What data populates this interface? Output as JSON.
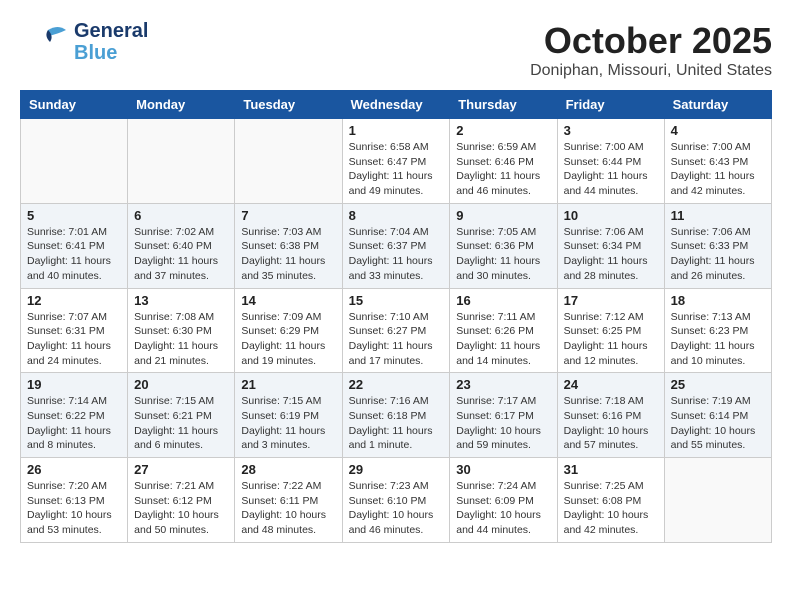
{
  "header": {
    "logo_general": "General",
    "logo_blue": "Blue",
    "month_year": "October 2025",
    "location": "Doniphan, Missouri, United States"
  },
  "weekdays": [
    "Sunday",
    "Monday",
    "Tuesday",
    "Wednesday",
    "Thursday",
    "Friday",
    "Saturday"
  ],
  "weeks": [
    [
      {
        "day": "",
        "info": ""
      },
      {
        "day": "",
        "info": ""
      },
      {
        "day": "",
        "info": ""
      },
      {
        "day": "1",
        "info": "Sunrise: 6:58 AM\nSunset: 6:47 PM\nDaylight: 11 hours and 49 minutes."
      },
      {
        "day": "2",
        "info": "Sunrise: 6:59 AM\nSunset: 6:46 PM\nDaylight: 11 hours and 46 minutes."
      },
      {
        "day": "3",
        "info": "Sunrise: 7:00 AM\nSunset: 6:44 PM\nDaylight: 11 hours and 44 minutes."
      },
      {
        "day": "4",
        "info": "Sunrise: 7:00 AM\nSunset: 6:43 PM\nDaylight: 11 hours and 42 minutes."
      }
    ],
    [
      {
        "day": "5",
        "info": "Sunrise: 7:01 AM\nSunset: 6:41 PM\nDaylight: 11 hours and 40 minutes."
      },
      {
        "day": "6",
        "info": "Sunrise: 7:02 AM\nSunset: 6:40 PM\nDaylight: 11 hours and 37 minutes."
      },
      {
        "day": "7",
        "info": "Sunrise: 7:03 AM\nSunset: 6:38 PM\nDaylight: 11 hours and 35 minutes."
      },
      {
        "day": "8",
        "info": "Sunrise: 7:04 AM\nSunset: 6:37 PM\nDaylight: 11 hours and 33 minutes."
      },
      {
        "day": "9",
        "info": "Sunrise: 7:05 AM\nSunset: 6:36 PM\nDaylight: 11 hours and 30 minutes."
      },
      {
        "day": "10",
        "info": "Sunrise: 7:06 AM\nSunset: 6:34 PM\nDaylight: 11 hours and 28 minutes."
      },
      {
        "day": "11",
        "info": "Sunrise: 7:06 AM\nSunset: 6:33 PM\nDaylight: 11 hours and 26 minutes."
      }
    ],
    [
      {
        "day": "12",
        "info": "Sunrise: 7:07 AM\nSunset: 6:31 PM\nDaylight: 11 hours and 24 minutes."
      },
      {
        "day": "13",
        "info": "Sunrise: 7:08 AM\nSunset: 6:30 PM\nDaylight: 11 hours and 21 minutes."
      },
      {
        "day": "14",
        "info": "Sunrise: 7:09 AM\nSunset: 6:29 PM\nDaylight: 11 hours and 19 minutes."
      },
      {
        "day": "15",
        "info": "Sunrise: 7:10 AM\nSunset: 6:27 PM\nDaylight: 11 hours and 17 minutes."
      },
      {
        "day": "16",
        "info": "Sunrise: 7:11 AM\nSunset: 6:26 PM\nDaylight: 11 hours and 14 minutes."
      },
      {
        "day": "17",
        "info": "Sunrise: 7:12 AM\nSunset: 6:25 PM\nDaylight: 11 hours and 12 minutes."
      },
      {
        "day": "18",
        "info": "Sunrise: 7:13 AM\nSunset: 6:23 PM\nDaylight: 11 hours and 10 minutes."
      }
    ],
    [
      {
        "day": "19",
        "info": "Sunrise: 7:14 AM\nSunset: 6:22 PM\nDaylight: 11 hours and 8 minutes."
      },
      {
        "day": "20",
        "info": "Sunrise: 7:15 AM\nSunset: 6:21 PM\nDaylight: 11 hours and 6 minutes."
      },
      {
        "day": "21",
        "info": "Sunrise: 7:15 AM\nSunset: 6:19 PM\nDaylight: 11 hours and 3 minutes."
      },
      {
        "day": "22",
        "info": "Sunrise: 7:16 AM\nSunset: 6:18 PM\nDaylight: 11 hours and 1 minute."
      },
      {
        "day": "23",
        "info": "Sunrise: 7:17 AM\nSunset: 6:17 PM\nDaylight: 10 hours and 59 minutes."
      },
      {
        "day": "24",
        "info": "Sunrise: 7:18 AM\nSunset: 6:16 PM\nDaylight: 10 hours and 57 minutes."
      },
      {
        "day": "25",
        "info": "Sunrise: 7:19 AM\nSunset: 6:14 PM\nDaylight: 10 hours and 55 minutes."
      }
    ],
    [
      {
        "day": "26",
        "info": "Sunrise: 7:20 AM\nSunset: 6:13 PM\nDaylight: 10 hours and 53 minutes."
      },
      {
        "day": "27",
        "info": "Sunrise: 7:21 AM\nSunset: 6:12 PM\nDaylight: 10 hours and 50 minutes."
      },
      {
        "day": "28",
        "info": "Sunrise: 7:22 AM\nSunset: 6:11 PM\nDaylight: 10 hours and 48 minutes."
      },
      {
        "day": "29",
        "info": "Sunrise: 7:23 AM\nSunset: 6:10 PM\nDaylight: 10 hours and 46 minutes."
      },
      {
        "day": "30",
        "info": "Sunrise: 7:24 AM\nSunset: 6:09 PM\nDaylight: 10 hours and 44 minutes."
      },
      {
        "day": "31",
        "info": "Sunrise: 7:25 AM\nSunset: 6:08 PM\nDaylight: 10 hours and 42 minutes."
      },
      {
        "day": "",
        "info": ""
      }
    ]
  ]
}
